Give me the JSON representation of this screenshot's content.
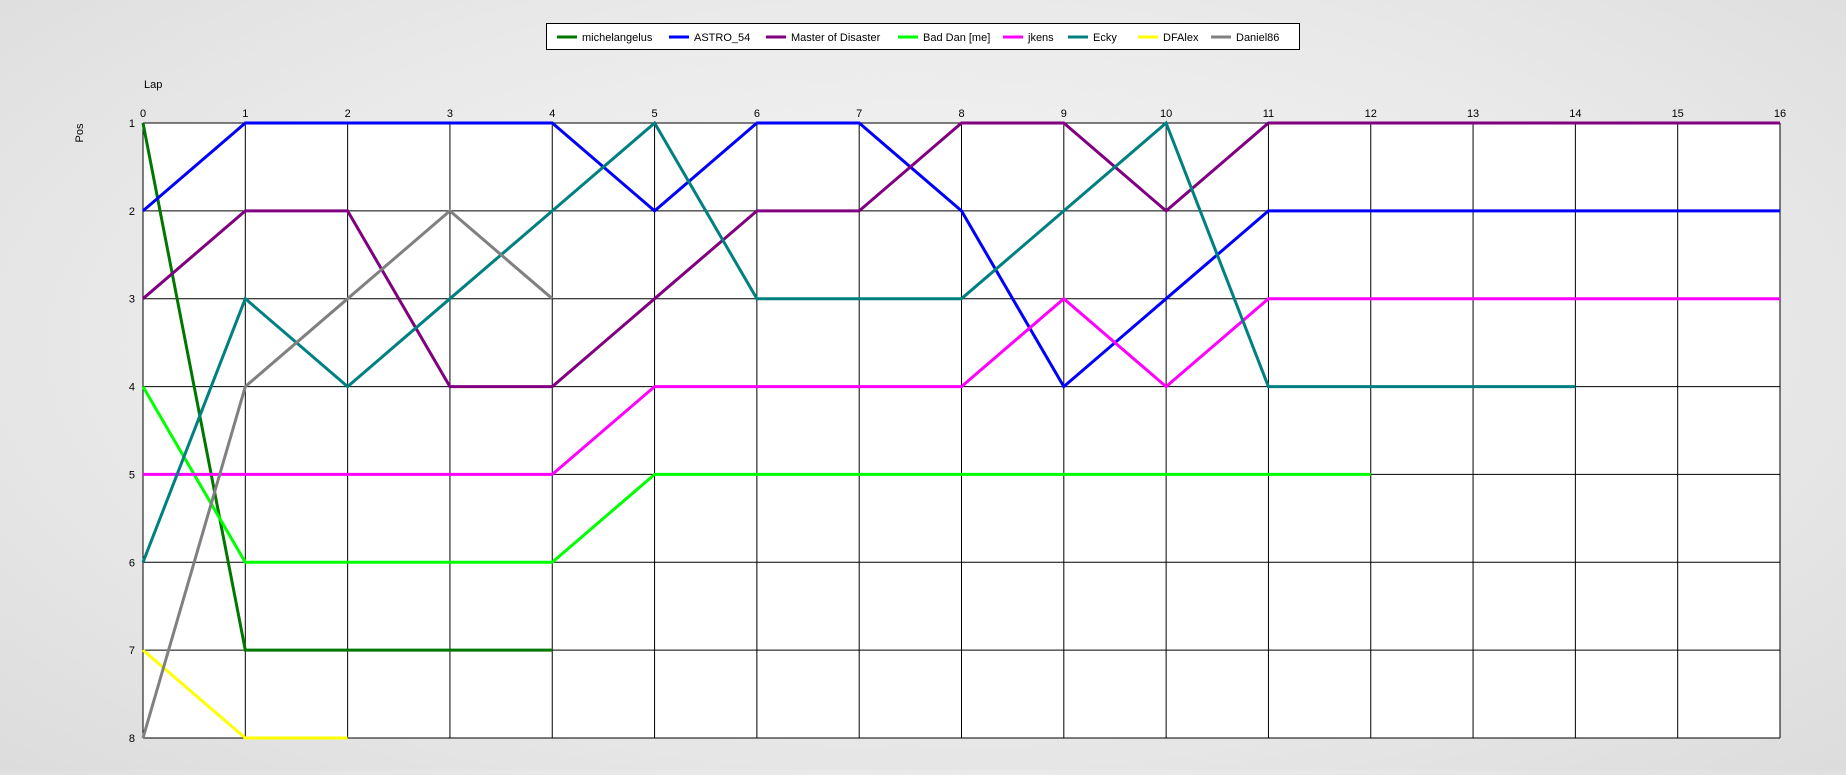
{
  "chart_data": {
    "type": "line",
    "xlabel": "Lap",
    "ylabel": "Pos",
    "xlim": [
      0,
      16
    ],
    "ylim": [
      1,
      8
    ],
    "y_inverted": true,
    "grid": true,
    "legend_position": "top-center",
    "x": [
      0,
      1,
      2,
      3,
      4,
      5,
      6,
      7,
      8,
      9,
      10,
      11,
      12,
      13,
      14,
      15,
      16
    ],
    "x_ticks": [
      "0",
      "1",
      "2",
      "3",
      "4",
      "5",
      "6",
      "7",
      "8",
      "9",
      "10",
      "11",
      "12",
      "13",
      "14",
      "15",
      "16"
    ],
    "y_ticks": [
      "1",
      "2",
      "3",
      "4",
      "5",
      "6",
      "7",
      "8"
    ],
    "series": [
      {
        "name": "michelangelus",
        "color": "#007800",
        "x": [
          0,
          1,
          2,
          3,
          4
        ],
        "values": [
          1,
          7,
          7,
          7,
          7
        ]
      },
      {
        "name": "ASTRO_54",
        "color": "#0000ff",
        "x": [
          0,
          1,
          2,
          3,
          4,
          5,
          6,
          7,
          8,
          9,
          10,
          11,
          12,
          13,
          14,
          15,
          16
        ],
        "values": [
          2,
          1,
          1,
          1,
          1,
          2,
          1,
          1,
          2,
          4,
          3,
          2,
          2,
          2,
          2,
          2,
          2
        ]
      },
      {
        "name": "Master of Disaster",
        "color": "#800080",
        "x": [
          0,
          1,
          2,
          3,
          4,
          5,
          6,
          7,
          8,
          9,
          10,
          11,
          12,
          13,
          14,
          15,
          16
        ],
        "values": [
          3,
          2,
          2,
          4,
          4,
          3,
          2,
          2,
          1,
          1,
          2,
          1,
          1,
          1,
          1,
          1,
          1
        ]
      },
      {
        "name": "Bad Dan [me]",
        "color": "#00ff00",
        "x": [
          0,
          1,
          2,
          3,
          4,
          5,
          6,
          7,
          8,
          9,
          10,
          11,
          12
        ],
        "values": [
          4,
          6,
          6,
          6,
          6,
          5,
          5,
          5,
          5,
          5,
          5,
          5,
          5
        ]
      },
      {
        "name": "jkens",
        "color": "#ff00ff",
        "x": [
          0,
          1,
          2,
          3,
          4,
          5,
          6,
          7,
          8,
          9,
          10,
          11,
          12,
          13,
          14,
          15,
          16
        ],
        "values": [
          5,
          5,
          5,
          5,
          5,
          4,
          4,
          4,
          4,
          3,
          4,
          3,
          3,
          3,
          3,
          3,
          3
        ]
      },
      {
        "name": "Ecky",
        "color": "#008080",
        "x": [
          0,
          1,
          2,
          3,
          4,
          5,
          6,
          7,
          8,
          9,
          10,
          11,
          12,
          13,
          14
        ],
        "values": [
          6,
          3,
          4,
          3,
          2,
          1,
          3,
          3,
          3,
          2,
          1,
          4,
          4,
          4,
          4
        ]
      },
      {
        "name": "DFAlex",
        "color": "#ffff00",
        "x": [
          0,
          1,
          2
        ],
        "values": [
          7,
          8,
          8
        ]
      },
      {
        "name": "Daniel86",
        "color": "#808080",
        "x": [
          0,
          1,
          2,
          3,
          4
        ],
        "values": [
          8,
          4,
          3,
          2,
          3
        ]
      }
    ]
  }
}
